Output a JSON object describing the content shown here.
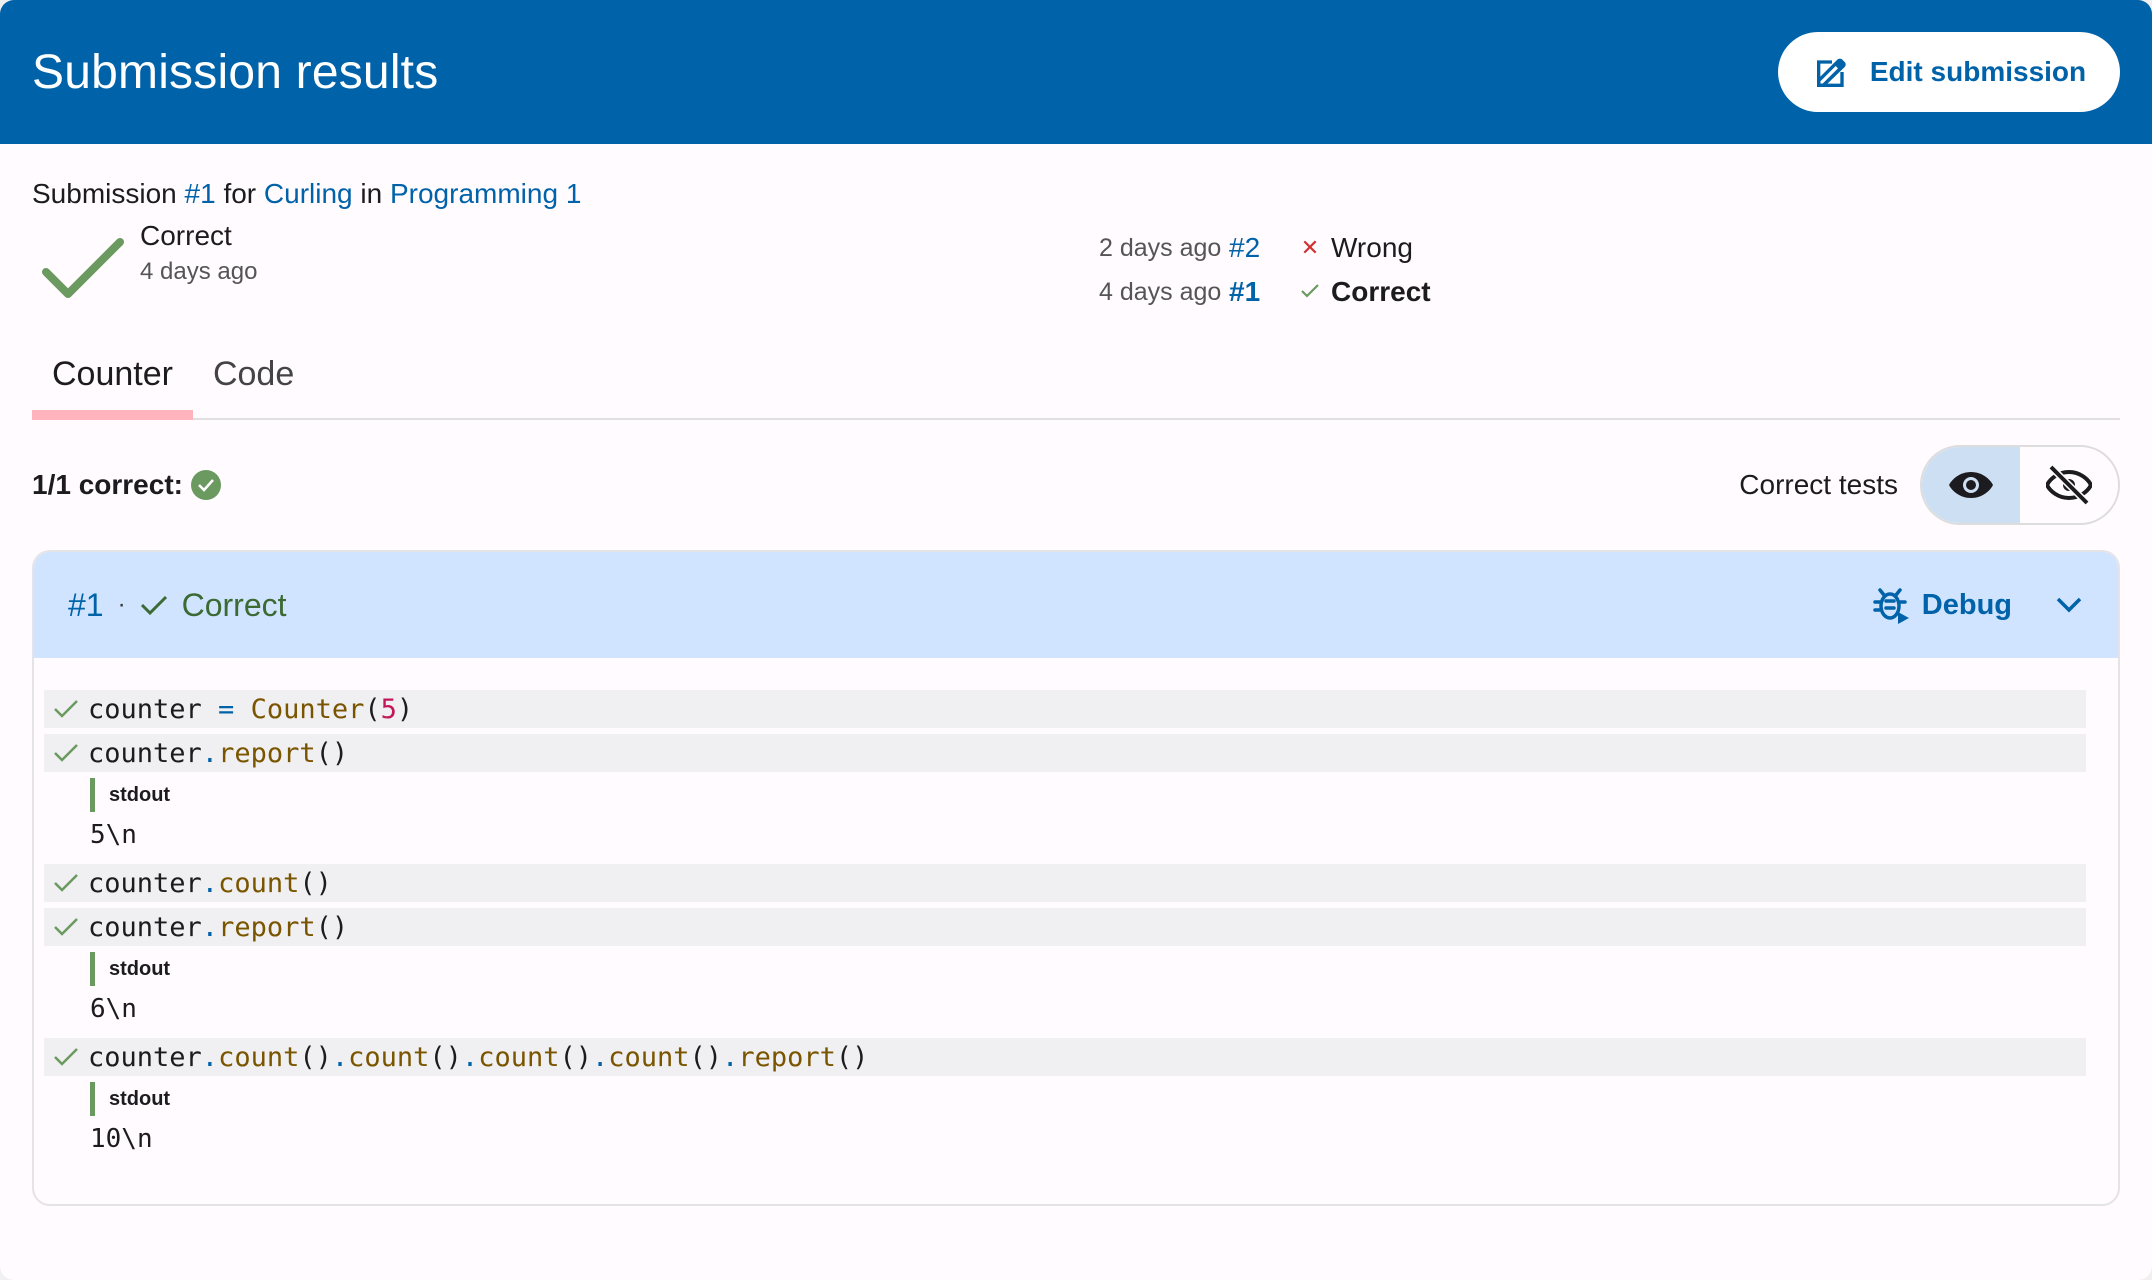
{
  "header": {
    "title": "Submission results",
    "edit_label": "Edit submission"
  },
  "submission": {
    "prefix": "Submission",
    "number": "#1",
    "for_word": "for",
    "exercise": "Curling",
    "in_word": "in",
    "course": "Programming 1",
    "status": "Correct",
    "time": "4 days ago"
  },
  "history": [
    {
      "time": "2 days ago",
      "number": "#2",
      "icon": "cross-icon",
      "status": "Wrong"
    },
    {
      "time": "4 days ago",
      "number": "#1",
      "icon": "check-icon",
      "status": "Correct"
    }
  ],
  "tabs": [
    {
      "label": "Counter"
    },
    {
      "label": "Code"
    }
  ],
  "summary": {
    "text": "1/1 correct:",
    "filter_label": "Correct tests"
  },
  "testcase": {
    "number": "#1",
    "separator": "·",
    "status": "Correct",
    "debug_label": "Debug",
    "statements": [
      {
        "parts": [
          "counter",
          " = ",
          "Counter",
          "(",
          "5",
          ")"
        ]
      },
      {
        "parts": [
          "counter",
          ".",
          "report",
          "()"
        ],
        "stdout_label": "stdout",
        "stdout": "5\\n"
      },
      {
        "parts": [
          "counter",
          ".",
          "count",
          "()"
        ]
      },
      {
        "parts": [
          "counter",
          ".",
          "report",
          "()"
        ],
        "stdout_label": "stdout",
        "stdout": "6\\n"
      },
      {
        "parts": [
          "counter",
          ".",
          "count",
          "()",
          ".",
          "count",
          "()",
          ".",
          "count",
          "()",
          ".",
          "count",
          "()",
          ".",
          "report",
          "()"
        ],
        "stdout_label": "stdout",
        "stdout": "10\\n"
      }
    ]
  },
  "colors": {
    "header": "#0062a8",
    "correct": "#6a9a5f",
    "wrong": "#d32f2f",
    "testcase_bg": "#d1e4ff"
  }
}
